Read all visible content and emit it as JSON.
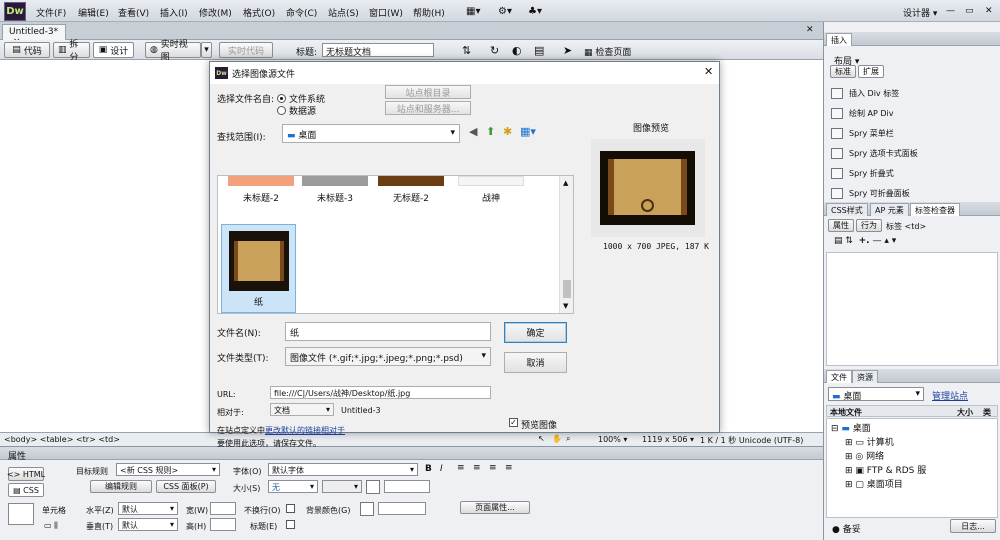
{
  "app": {
    "logo": "Dw",
    "menu": [
      "文件(F)",
      "编辑(E)",
      "查看(V)",
      "插入(I)",
      "修改(M)",
      "格式(O)",
      "命令(C)",
      "站点(S)",
      "窗口(W)",
      "帮助(H)"
    ],
    "workspace": "设计器",
    "doc_tab": "Untitled-3*"
  },
  "toolbar": {
    "code": "代码",
    "split": "拆分",
    "design": "设计",
    "live_view": "实时视图",
    "live_code": "实时代码",
    "title_label": "标题:",
    "title_value": "无标题文档",
    "check_page": "检查页面"
  },
  "statusbar": {
    "tags": "<body> <table> <tr> <td>",
    "zoom": "100%",
    "size": "1119 x 506",
    "info": "1 K / 1 秒  Unicode (UTF-8)"
  },
  "properties": {
    "header": "属性",
    "html_btn": "HTML",
    "css_btn": "CSS",
    "target_rule_label": "目标规则",
    "target_rule_value": "<新 CSS 规则>",
    "edit_rule": "编辑规则",
    "css_panel": "CSS 面板(P)",
    "font_label": "字体(O)",
    "font_value": "默认字体",
    "size_label": "大小(S)",
    "size_value": "无",
    "cell_label": "单元格",
    "horz_label": "水平(Z)",
    "horz_value": "默认",
    "vert_label": "垂直(T)",
    "vert_value": "默认",
    "width_label": "宽(W)",
    "height_label": "高(H)",
    "nowrap_label": "不换行(O)",
    "header_label": "标题(E)",
    "bg_label": "背景颜色(G)",
    "page_props": "页面属性..."
  },
  "right_panel": {
    "insert_tab": "插入",
    "layout_label": "布局",
    "std_tab": "标准",
    "ext_tab": "扩展",
    "insert_items": [
      "插入 Div 标签",
      "绘制 AP Div",
      "Spry 菜单栏",
      "Spry 选项卡式面板",
      "Spry 折叠式",
      "Spry 可折叠面板"
    ],
    "css_tabs": [
      "CSS样式",
      "AP 元素",
      "标签检查器"
    ],
    "attr_tabs": [
      "属性",
      "行为",
      "标签 <td>"
    ],
    "files_tabs": [
      "文件",
      "资源"
    ],
    "site_select": "桌面",
    "manage_sites": "管理站点",
    "local_files": "本地文件",
    "size_col": "大小",
    "type_col": "类",
    "tree": [
      "桌面",
      "计算机",
      "网络",
      "FTP & RDS 服",
      "桌面项目"
    ],
    "bottom_ready": "备妥",
    "bottom_log": "日志..."
  },
  "dialog": {
    "title": "选择图像源文件",
    "select_from": "选择文件名自:",
    "opt_filesystem": "文件系统",
    "opt_datasource": "数据源",
    "site_root": "站点根目录",
    "site_server": "站点和服务器...",
    "look_in_label": "查找范围(I):",
    "look_in_value": "桌面",
    "preview_label": "图像预览",
    "preview_info": "1000 x 700 JPEG, 187 K",
    "files": [
      "未标题-2",
      "未标题-3",
      "无标题-2",
      "战神",
      "纸"
    ],
    "filename_label": "文件名(N):",
    "filename_value": "纸",
    "filetype_label": "文件类型(T):",
    "filetype_value": "图像文件 (*.gif;*.jpg;*.jpeg;*.png;*.psd)",
    "ok": "确定",
    "cancel": "取消",
    "url_label": "URL:",
    "url_value": "file:///C|/Users/战神/Desktop/纸.jpg",
    "relative_label": "相对于:",
    "relative_value": "文档",
    "relative_doc": "Untitled-3",
    "note1_pre": "在站点定义中",
    "note1_link": "更改默认的链接相对于",
    "note2": "要使用此选项，请保存文件。",
    "preview_checkbox": "预览图像"
  },
  "colors": {
    "accent": "#3c7fb1",
    "link": "#1a3fa0",
    "selection": "#cce4f7",
    "scroll_paper": "#c9a15a"
  }
}
